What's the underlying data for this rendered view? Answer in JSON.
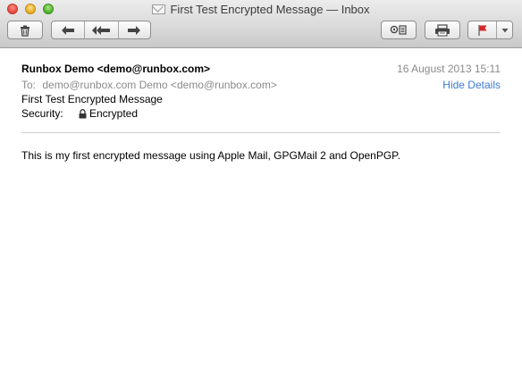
{
  "window": {
    "title": "First Test Encrypted Message — Inbox",
    "title_icon": "envelope-icon"
  },
  "toolbar": {
    "delete_icon": "trash-icon",
    "reply_icon": "reply-arrow-icon",
    "reply_all_icon": "reply-all-arrow-icon",
    "forward_icon": "forward-arrow-icon",
    "gpg_icon": "gpg-key-icon",
    "print_icon": "printer-icon",
    "flag_icon": "red-flag-icon",
    "flag_color": "#d62828",
    "dropdown_icon": "chevron-down-icon"
  },
  "message": {
    "from": "Runbox Demo <demo@runbox.com>",
    "date": "16 August 2013 15:11",
    "to_label": "To:",
    "to_value": "demo@runbox.com Demo <demo@runbox.com>",
    "hide_details": "Hide Details",
    "subject": "First Test Encrypted Message",
    "security_label": "Security:",
    "security_value": "Encrypted",
    "security_icon": "lock-icon",
    "body": "This is my first encrypted message using Apple Mail, GPGMail 2 and OpenPGP."
  },
  "colors": {
    "link": "#3d7bd6",
    "muted": "#8a8a8a"
  }
}
